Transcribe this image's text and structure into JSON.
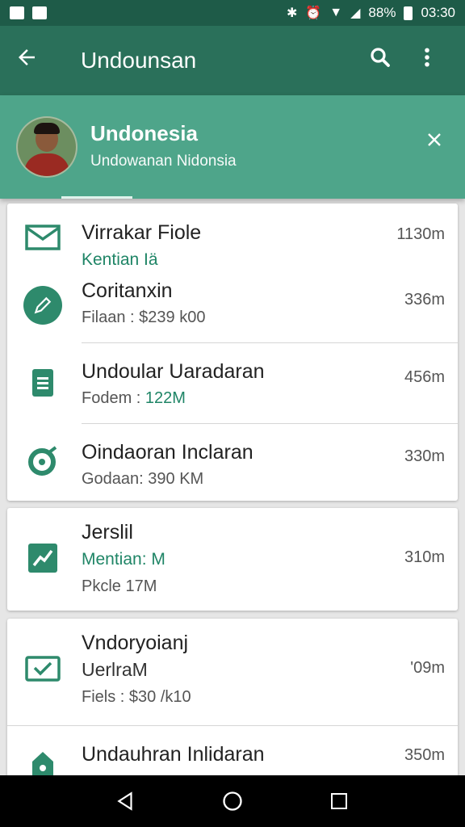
{
  "status_bar": {
    "battery": "88%",
    "time": "03:30"
  },
  "app_bar": {
    "title": "Undounsan",
    "icons": [
      "back-arrow-icon",
      "search-icon",
      "more-vert-icon"
    ]
  },
  "profile": {
    "name": "Undonesia",
    "subtitle": "Undowanan Nidonsia"
  },
  "cards": [
    {
      "items": [
        {
          "icon": "mail-icon",
          "title": "Virrakar Fiole",
          "accent": "Kentian Iä",
          "distance": "1130m"
        },
        {
          "icon": "edit-icon",
          "title": "Coritanxin",
          "detail": "Filaan : $239 k00",
          "distance": "336m"
        },
        {
          "icon": "document-icon",
          "title": "Undoular Uaradaran",
          "detail": "Fodem : ",
          "detail_accent": "122M",
          "distance": "456m"
        },
        {
          "icon": "target-icon",
          "title": "Oindaoran Inclaran",
          "detail": "Godaan: 390 KM",
          "distance": "330m"
        }
      ]
    },
    {
      "items": [
        {
          "icon": "trend-icon",
          "title": "Jerslil",
          "accent": "Mentian: M",
          "detail": "Pkcle 17M",
          "distance": "310m"
        }
      ]
    },
    {
      "items": [
        {
          "icon": "check-mail-icon",
          "title": "Vndoryoianj",
          "accent_dark": "UerlraM",
          "detail": "Fiels : $30 /k10",
          "distance": "'09m"
        },
        {
          "icon": "home-icon",
          "title": "Undauhran Inlidaran",
          "distance": "350m"
        }
      ]
    }
  ],
  "colors": {
    "app_bar": "#2a705a",
    "status_bar": "#1e5b48",
    "profile_banner": "#4ea58a",
    "accent": "#1f8566"
  }
}
